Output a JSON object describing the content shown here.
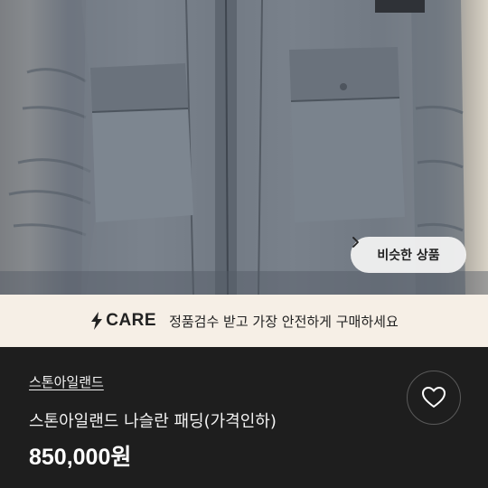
{
  "product_image": {
    "alt": "",
    "similar_button": {
      "label": "비슷한 상품",
      "icon": "chevron-right-icon"
    }
  },
  "care_banner": {
    "brand": "CARE",
    "brand_icon": "lightning-bolt-icon",
    "message": "정품검수 받고 가장 안전하게 구매하세요",
    "background": "#f6efe6"
  },
  "product": {
    "store": "스톤아일랜드",
    "title": "스톤아일랜드 나슬란 패딩(가격인하)",
    "price": "850,000원",
    "like_icon": "heart-outline-icon"
  },
  "colors": {
    "panel_bg": "#1e1e1e",
    "text": "#f2f2f2"
  }
}
